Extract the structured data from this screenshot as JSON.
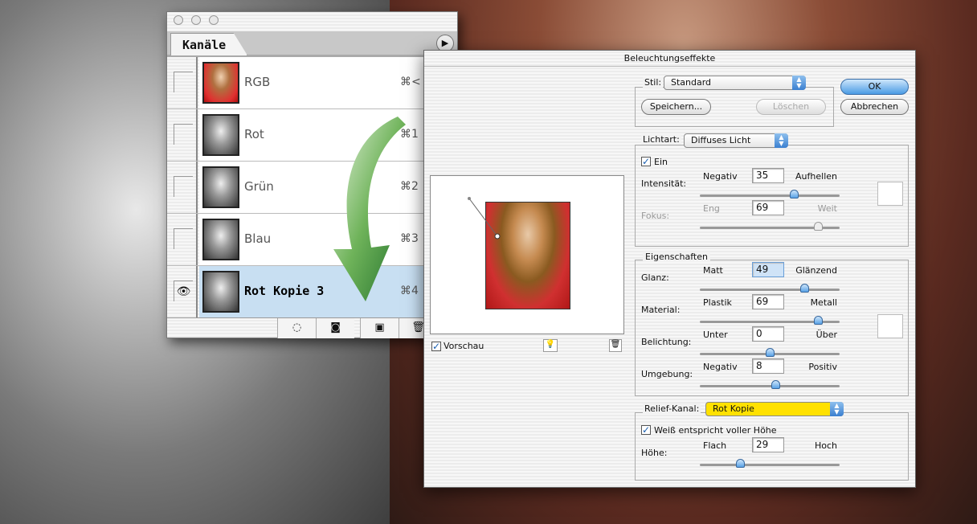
{
  "channels_panel": {
    "tab": "Kanäle",
    "menu_icon": "triangle-right-icon",
    "channels": [
      {
        "name": "RGB",
        "shortcut": "⌘<",
        "visible": false,
        "thumb": "color"
      },
      {
        "name": "Rot",
        "shortcut": "⌘1",
        "visible": false,
        "thumb": "gray"
      },
      {
        "name": "Grün",
        "shortcut": "⌘2",
        "visible": false,
        "thumb": "gray"
      },
      {
        "name": "Blau",
        "shortcut": "⌘3",
        "visible": false,
        "thumb": "gray"
      },
      {
        "name": "Rot Kopie 3",
        "shortcut": "⌘4",
        "visible": true,
        "selected": true,
        "thumb": "gray"
      }
    ],
    "footer_icons": [
      "load-selection-icon",
      "save-selection-icon",
      "new-channel-icon",
      "trash-icon"
    ],
    "selection_color": "#c8dff2"
  },
  "dialog": {
    "title": "Beleuchtungseffekte",
    "ok": "OK",
    "cancel": "Abbrechen",
    "stil_label": "Stil:",
    "stil_value": "Standard",
    "save": "Speichern...",
    "delete": "Löschen",
    "lichtart_label": "Lichtart:",
    "lichtart_value": "Diffuses Licht",
    "ein_label": "Ein",
    "ein_checked": true,
    "preview_label": "Vorschau",
    "preview_checked": true,
    "eigenschaften": "Eigenschaften",
    "relief_label": "Relief-Kanal:",
    "relief_value": "Rot Kopie",
    "relief_color": "#ffe100",
    "weiss_label": "Weiß entspricht voller Höhe",
    "weiss_checked": true,
    "sliders": {
      "intensitaet": {
        "label": "Intensität:",
        "min_label": "Negativ",
        "max_label": "Aufhellen",
        "value": "35",
        "min": -100,
        "max": 100
      },
      "fokus": {
        "label": "Fokus:",
        "min_label": "Eng",
        "max_label": "Weit",
        "value": "69",
        "min": -100,
        "max": 100,
        "disabled": true
      },
      "glanz": {
        "label": "Glanz:",
        "min_label": "Matt",
        "max_label": "Glänzend",
        "value": "49",
        "min": -100,
        "max": 100
      },
      "material": {
        "label": "Material:",
        "min_label": "Plastik",
        "max_label": "Metall",
        "value": "69",
        "min": -100,
        "max": 100
      },
      "belichtung": {
        "label": "Belichtung:",
        "min_label": "Unter",
        "max_label": "Über",
        "value": "0",
        "min": -100,
        "max": 100
      },
      "umgebung": {
        "label": "Umgebung:",
        "min_label": "Negativ",
        "max_label": "Positiv",
        "value": "8",
        "min": -100,
        "max": 100
      },
      "hoehe": {
        "label": "Höhe:",
        "min_label": "Flach",
        "max_label": "Hoch",
        "value": "29",
        "min": 0,
        "max": 100
      }
    }
  }
}
